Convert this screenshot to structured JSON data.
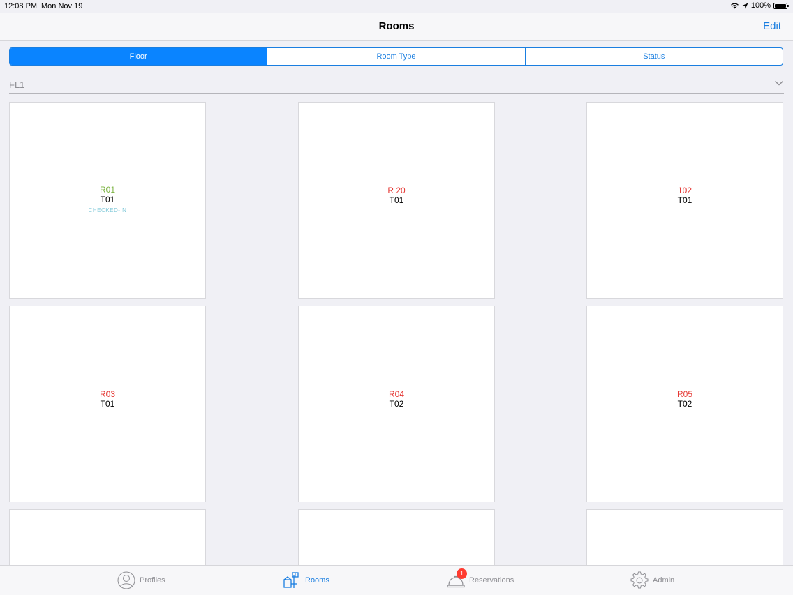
{
  "status_bar": {
    "time": "12:08 PM",
    "date": "Mon Nov 19",
    "battery": "100%"
  },
  "navbar": {
    "title": "Rooms",
    "edit_label": "Edit"
  },
  "segments": [
    {
      "label": "Floor",
      "active": true
    },
    {
      "label": "Room Type",
      "active": false
    },
    {
      "label": "Status",
      "active": false
    }
  ],
  "floor": {
    "label": "FL1"
  },
  "rooms": [
    {
      "name": "R01",
      "type": "T01",
      "status": "CHECKED-IN",
      "name_color": "#7cb342",
      "status_color": "#7fc8d8"
    },
    {
      "name": "R 20",
      "type": "T01",
      "status": "",
      "name_color": "#e53935",
      "status_color": ""
    },
    {
      "name": "102",
      "type": "T01",
      "status": "",
      "name_color": "#e53935",
      "status_color": ""
    },
    {
      "name": "R03",
      "type": "T01",
      "status": "",
      "name_color": "#e53935",
      "status_color": ""
    },
    {
      "name": "R04",
      "type": "T02",
      "status": "",
      "name_color": "#e53935",
      "status_color": ""
    },
    {
      "name": "R05",
      "type": "T02",
      "status": "",
      "name_color": "#e53935",
      "status_color": ""
    },
    {
      "name": "",
      "type": "",
      "status": "",
      "name_color": "#e53935",
      "status_color": ""
    },
    {
      "name": "",
      "type": "",
      "status": "",
      "name_color": "#e53935",
      "status_color": ""
    },
    {
      "name": "",
      "type": "",
      "status": "",
      "name_color": "#e53935",
      "status_color": ""
    }
  ],
  "tabs": [
    {
      "label": "Profiles",
      "icon": "person-icon",
      "active": false
    },
    {
      "label": "Rooms",
      "icon": "housekeeping-icon",
      "active": true
    },
    {
      "label": "Reservations",
      "icon": "bell-icon",
      "active": false,
      "badge": "1"
    },
    {
      "label": "Admin",
      "icon": "gear-icon",
      "active": false
    }
  ],
  "colors": {
    "accent": "#1a7ee0",
    "segment_active": "#0a84ff",
    "inactive_tab": "#8e8e93",
    "badge": "#ff3b30"
  }
}
